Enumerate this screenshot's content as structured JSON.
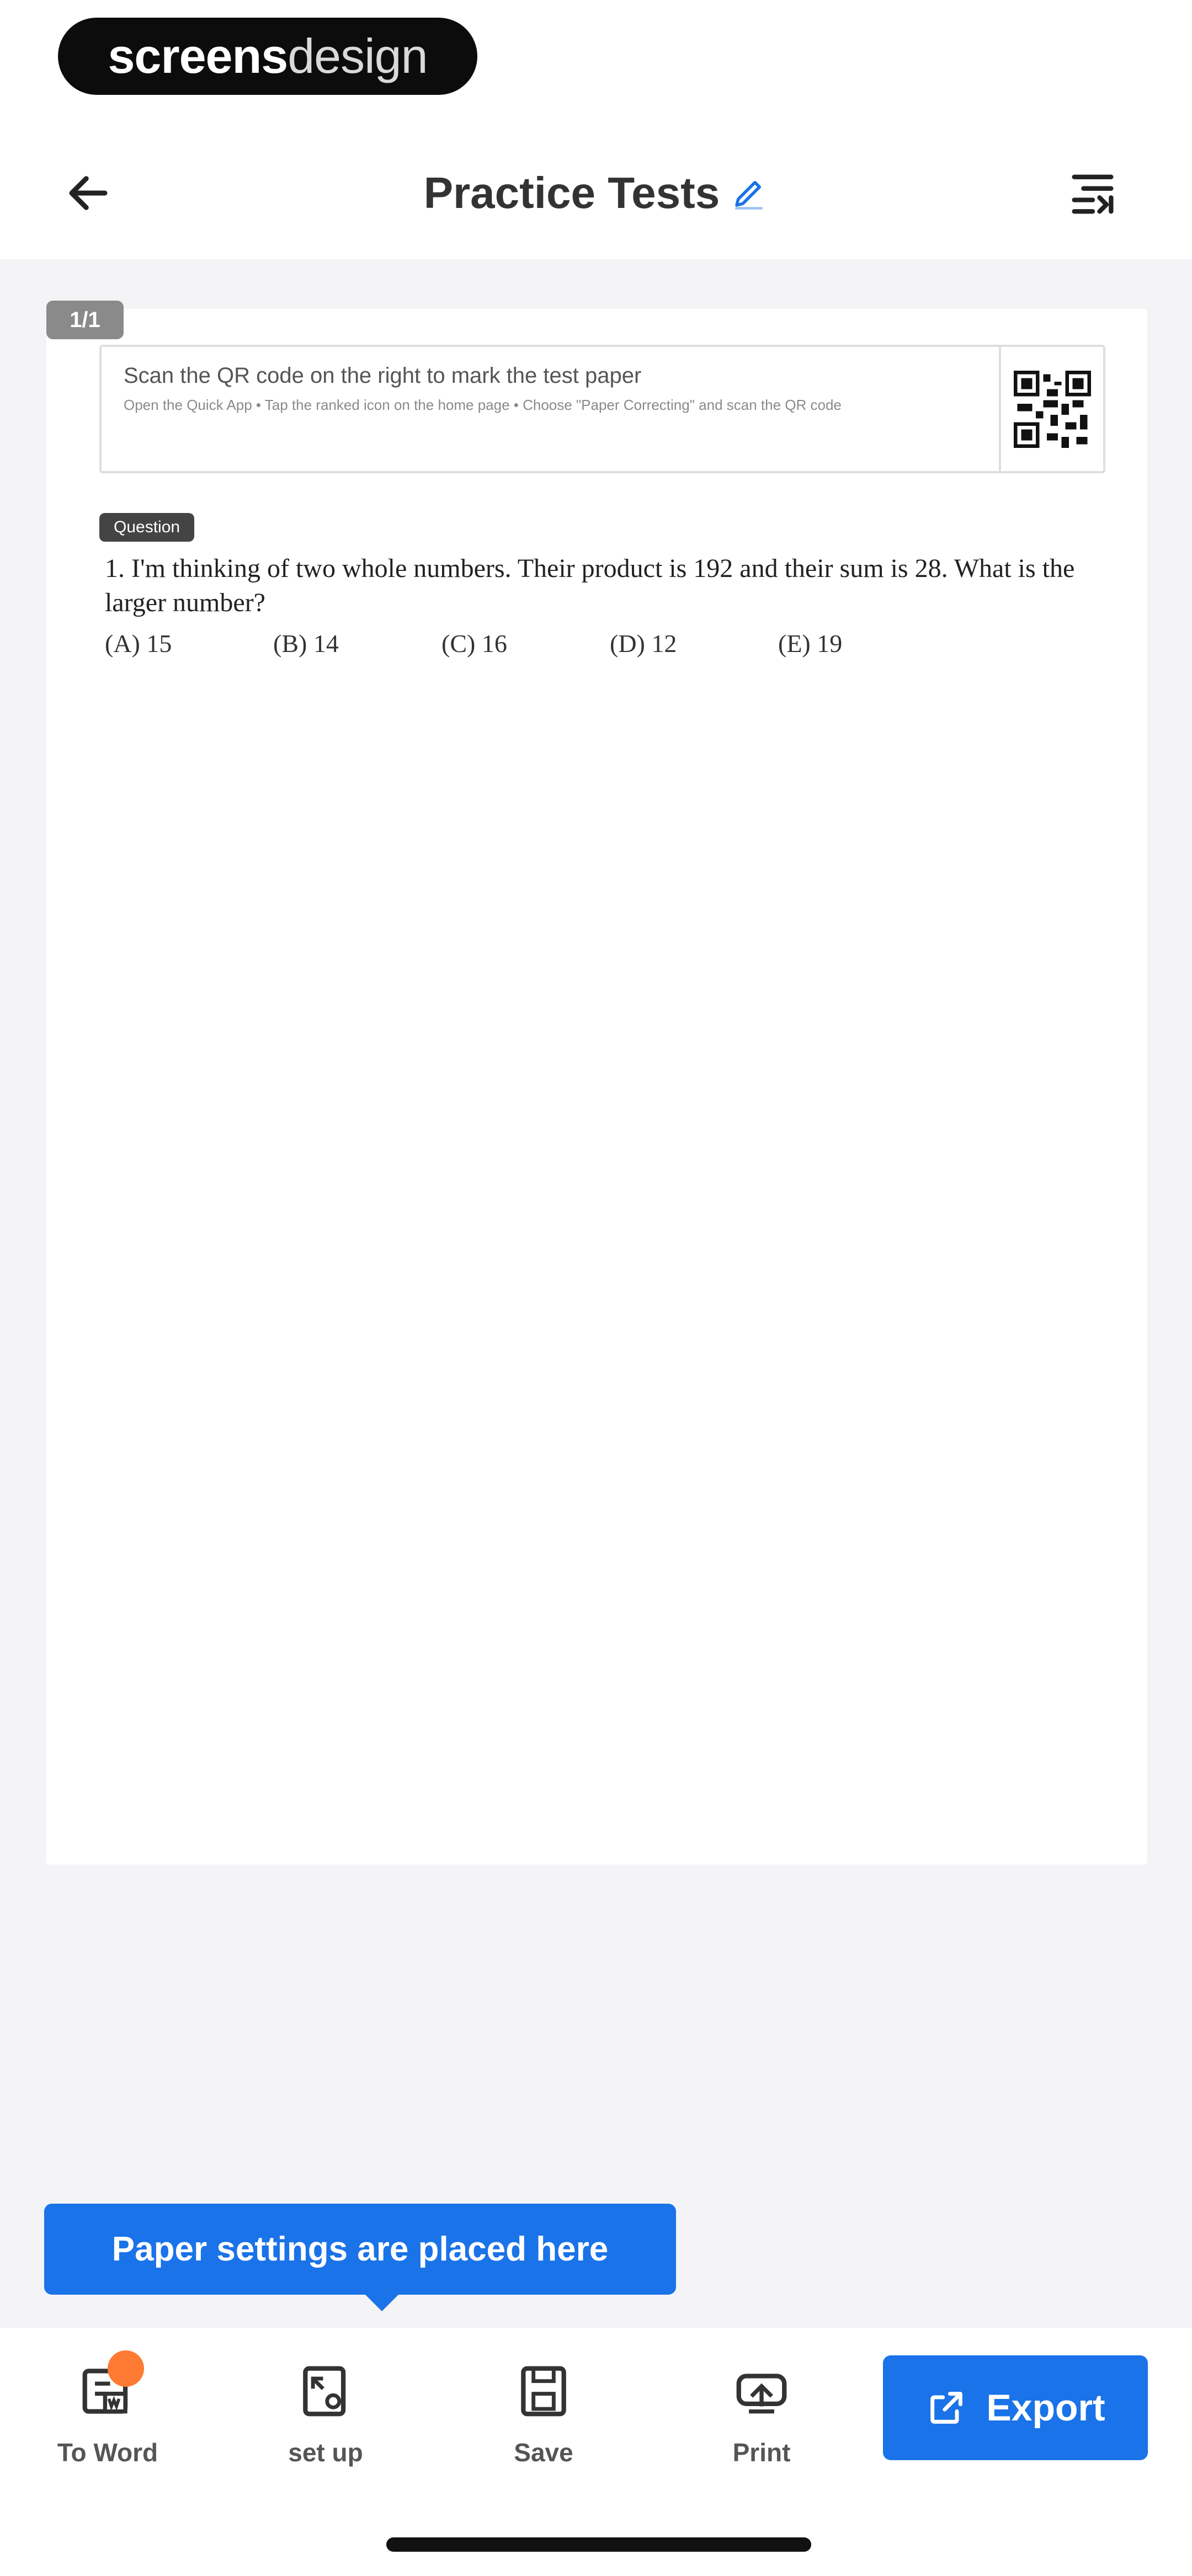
{
  "watermark": {
    "part1": "screens",
    "part2": "design"
  },
  "header": {
    "title": "Practice Tests"
  },
  "paper": {
    "page_badge": "1/1",
    "qr_instructions": {
      "line1": "Scan the QR code on the right to mark the test paper",
      "line2": "Open the Quick App • Tap the ranked icon on the home page • Choose \"Paper Correcting\" and scan the QR code"
    },
    "question_tag": "Question",
    "question": {
      "text": "1. I'm thinking of two whole numbers. Their product is 192 and their sum is 28. What is the larger number?",
      "options": [
        "(A) 15",
        "(B) 14",
        "(C) 16",
        "(D) 12",
        "(E) 19"
      ]
    }
  },
  "tooltip": {
    "text": "Paper settings are placed here"
  },
  "toolbar": {
    "items": [
      {
        "label": "To Word"
      },
      {
        "label": "set up"
      },
      {
        "label": "Save"
      },
      {
        "label": "Print"
      }
    ],
    "export_label": "Export"
  },
  "colors": {
    "accent": "#1a73e8",
    "badge": "#ff7a33",
    "content_bg": "#f4f4f6"
  }
}
